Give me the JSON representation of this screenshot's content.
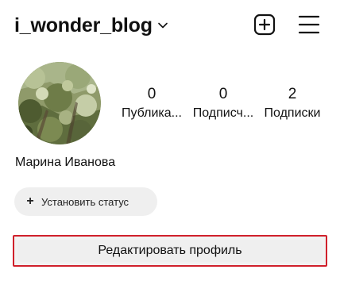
{
  "header": {
    "username": "i_wonder_blog",
    "chevron_icon": "chevron-down-icon",
    "add_icon": "plus-square-icon",
    "menu_icon": "hamburger-menu-icon"
  },
  "profile": {
    "full_name": "Марина Иванова",
    "avatar_description": "avatar-photo"
  },
  "stats": [
    {
      "value": "0",
      "label": "Публика..."
    },
    {
      "value": "0",
      "label": "Подписч..."
    },
    {
      "value": "2",
      "label": "Подписки"
    }
  ],
  "status": {
    "plus": "+",
    "label": "Установить статус"
  },
  "edit_profile": {
    "label": "Редактировать профиль",
    "highlight_color": "#d0202b"
  }
}
